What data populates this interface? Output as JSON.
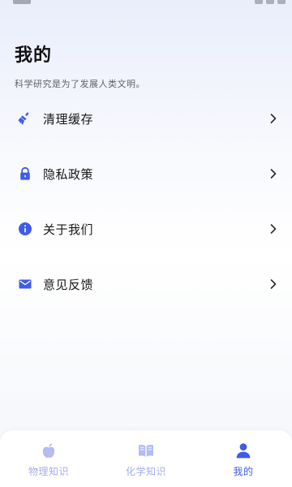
{
  "colors": {
    "accent": "#3f5bea",
    "inactive_tab": "#b4bcf0",
    "chevron": "#2c2c2c"
  },
  "header": {
    "title": "我的",
    "subtitle": "科学研究是为了发展人类文明。"
  },
  "menu": {
    "items": [
      {
        "label": "清理缓存",
        "icon": "broom-icon"
      },
      {
        "label": "隐私政策",
        "icon": "lock-icon"
      },
      {
        "label": "关于我们",
        "icon": "info-icon"
      },
      {
        "label": "意见反馈",
        "icon": "mail-icon"
      }
    ]
  },
  "tabs": [
    {
      "label": "物理知识",
      "icon": "apple-icon",
      "active": false
    },
    {
      "label": "化学知识",
      "icon": "book-icon",
      "active": false
    },
    {
      "label": "我的",
      "icon": "person-icon",
      "active": true
    }
  ]
}
